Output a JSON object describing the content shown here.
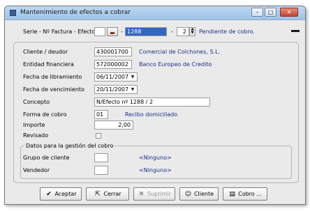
{
  "window": {
    "title": "Mantenimiento de efectos a cobrar",
    "controls": {
      "minimize": "–",
      "maximize": "□",
      "close": "✕"
    }
  },
  "header": {
    "label": "Serie - Nº Factura - Efecto",
    "serie_value": "",
    "sep1": "-",
    "factura_value": "1288",
    "sep2": "-",
    "efecto_value": "2",
    "status": "Pendiente de cobro."
  },
  "form": {
    "cliente": {
      "label": "Cliente / deudor",
      "value": "430001700",
      "name": "Comercial de Colchones, S.L."
    },
    "entidad": {
      "label": "Entidad financiera",
      "value": "572000002",
      "name": "Banco Europeo de Credito"
    },
    "fecha_libramiento": {
      "label": "Fecha de libramiento",
      "value": "06/11/2007"
    },
    "fecha_vencimiento": {
      "label": "Fecha de vencimiento",
      "value": "20/11/2007"
    },
    "concepto": {
      "label": "Concepto",
      "value": "N/Efecto nº  1288 / 2"
    },
    "forma_cobro": {
      "label": "Forma de cobro",
      "value": "01",
      "name": "Recibo domiciliado"
    },
    "importe": {
      "label": "Importe",
      "value": "2,00"
    },
    "revisado": {
      "label": "Revisado",
      "checked": false
    }
  },
  "gestion": {
    "title": "Datos para la gestión del cobro",
    "grupo": {
      "label": "Grupo de cliente",
      "value": "",
      "name": "<Ninguno>"
    },
    "vendedor": {
      "label": "Vendedor",
      "value": "",
      "name": "<Ninguno>"
    }
  },
  "buttons": {
    "aceptar": "Aceptar",
    "cerrar": "Cerrar",
    "suprimir": "Suprimir",
    "cliente": "Cliente",
    "cobro": "Cobro ..."
  },
  "icons": {
    "aceptar": "check-icon",
    "cerrar": "exit-icon",
    "suprimir": "delete-icon",
    "cliente": "person-icon",
    "cobro": "payment-icon"
  }
}
